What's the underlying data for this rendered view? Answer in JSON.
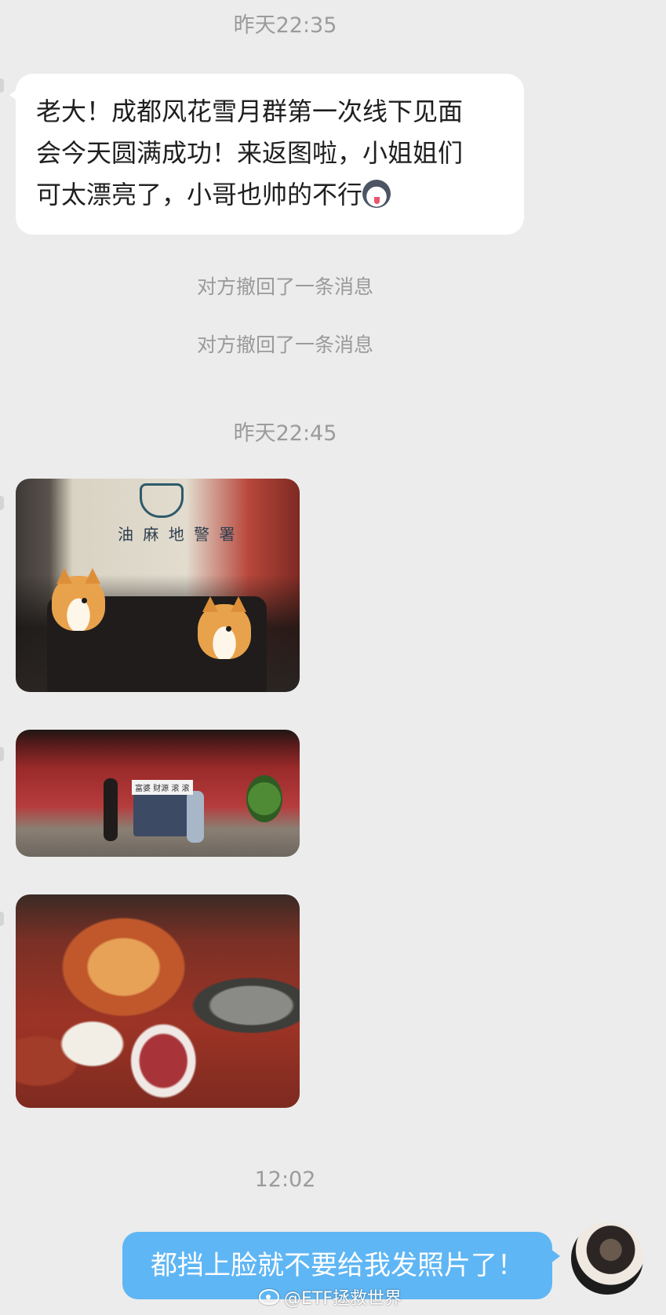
{
  "chat": {
    "timestamp_1": "昨天22:35",
    "incoming_text_line1": "老大！成都风花雪月群第一次线下见面",
    "incoming_text_line2": "会今天圆满成功！来返图啦，小姐姐们",
    "incoming_text_line3": "可太漂亮了，小哥也帅的不行",
    "incoming_emoji": "husky-emoji-icon",
    "recall_notice_1": "对方撤回了一条消息",
    "recall_notice_2": "对方撤回了一条消息",
    "timestamp_2": "昨天22:45",
    "photo_1_sign": "油 麻 地 警 署",
    "photo_2_sign": "富婆 财源 滚 滚",
    "timestamp_3": "12:02",
    "outgoing_text": "都挡上脸就不要给我发照片了！"
  },
  "watermark": {
    "text": "@ETF拯救世界",
    "icon": "weibo-icon"
  },
  "colors": {
    "background": "#ececec",
    "incoming_bubble": "#ffffff",
    "outgoing_bubble": "#5fb6f4",
    "timestamp_text": "#9b9b9b"
  }
}
